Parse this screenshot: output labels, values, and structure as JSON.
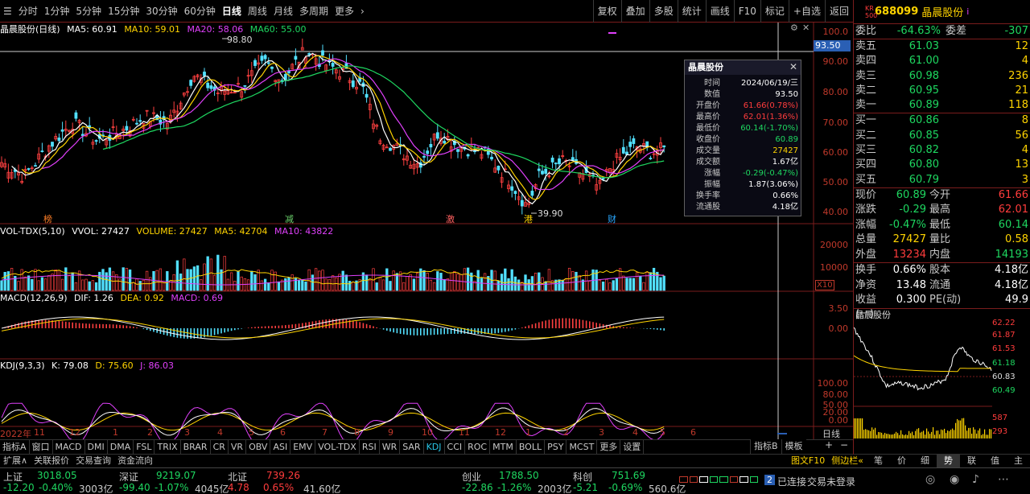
{
  "toolbar": {
    "periods": [
      "分时",
      "1分钟",
      "5分钟",
      "15分钟",
      "30分钟",
      "60分钟",
      "日线",
      "周线",
      "月线",
      "多周期",
      "更多"
    ],
    "active": "日线",
    "right_buttons": [
      "复权",
      "叠加",
      "多股",
      "统计",
      "画线",
      "F10",
      "标记",
      "+自选",
      "返回"
    ]
  },
  "main_chart": {
    "title": "晶晨股份(日线)",
    "ma5": "MA5: 60.91",
    "ma10": "MA10: 59.01",
    "ma20": "MA20: 58.06",
    "ma60": "MA60: 55.00",
    "high_mark": "98.80",
    "low_mark": "39.90",
    "cursor_price": "93.50",
    "y_labels": [
      "100.0",
      "90.00",
      "80.00",
      "70.00",
      "60.00",
      "50.00",
      "40.00"
    ],
    "event_marks": [
      "榜",
      "减",
      "激",
      "港",
      "财"
    ]
  },
  "popup": {
    "title": "晶晨股份",
    "rows": [
      {
        "k": "时间",
        "v": "2024/06/19/三",
        "c": "wht"
      },
      {
        "k": "数值",
        "v": "93.50",
        "c": "wht"
      },
      {
        "k": "开盘价",
        "v": "61.66(0.78%)",
        "c": "red"
      },
      {
        "k": "最高价",
        "v": "62.01(1.36%)",
        "c": "red"
      },
      {
        "k": "最低价",
        "v": "60.14(-1.70%)",
        "c": "grn"
      },
      {
        "k": "收盘价",
        "v": "60.89",
        "c": "grn"
      },
      {
        "k": "成交量",
        "v": "27427",
        "c": "yel"
      },
      {
        "k": "成交额",
        "v": "1.67亿",
        "c": "wht"
      },
      {
        "k": "涨幅",
        "v": "-0.29(-0.47%)",
        "c": "grn"
      },
      {
        "k": "振幅",
        "v": "1.87(3.06%)",
        "c": "wht"
      },
      {
        "k": "换手率",
        "v": "0.66%",
        "c": "wht"
      },
      {
        "k": "流通股",
        "v": "4.18亿",
        "c": "wht"
      }
    ]
  },
  "volume": {
    "label": "VOL-TDX(5,10)",
    "vvol": "VVOL: 27427",
    "volume": "VOLUME: 27427",
    "ma5": "MA5: 42704",
    "ma10": "MA10: 43822",
    "y_labels": [
      "20000",
      "10000"
    ],
    "unit": "X10"
  },
  "macd": {
    "label": "MACD(12,26,9)",
    "dif": "DIF: 1.26",
    "dea": "DEA: 0.92",
    "macd": "MACD: 0.69",
    "y_labels": [
      "3.50",
      "0.00"
    ]
  },
  "kdj": {
    "label": "KDJ(9,3,3)",
    "k": "K: 79.08",
    "d": "D: 75.60",
    "j": "J: 86.03",
    "y_labels": [
      "100.00",
      "80.00",
      "50.00",
      "20.00",
      "0.00"
    ]
  },
  "time_axis": [
    "2022年",
    "11",
    "12",
    "1",
    "2",
    "3",
    "4",
    "5",
    "6",
    "7",
    "8",
    "9",
    "10",
    "11",
    "12",
    "1",
    "2",
    "3",
    "4",
    "5",
    "6"
  ],
  "time_axis_right": "日线",
  "indicator_tabs": [
    "指标A",
    "窗口",
    "MACD",
    "DMI",
    "DMA",
    "FSL",
    "TRIX",
    "BRAR",
    "CR",
    "VR",
    "OBV",
    "ASI",
    "EMV",
    "VOL-TDX",
    "RSI",
    "WR",
    "SAR",
    "KDJ",
    "CCI",
    "ROC",
    "MTM",
    "BOLL",
    "PSY",
    "MCST",
    "更多",
    "设置"
  ],
  "indicator_active": "KDJ",
  "indicator_right": [
    "指标B",
    "模板"
  ],
  "bottom_tabs": [
    "扩展∧",
    "关联报价",
    "交易查询",
    "资金流向"
  ],
  "bottom_right_tabs": [
    "图文F10",
    "侧边栏«",
    "笔",
    "价",
    "细",
    "势",
    "联",
    "值",
    "主"
  ],
  "quote": {
    "code_label": "688099",
    "name": "晶晨股份",
    "tag": "KR",
    "tag2": "500",
    "weibi": {
      "k": "委比",
      "v": "-64.63%",
      "k2": "委差",
      "v2": "-307"
    },
    "sells": [
      {
        "k": "卖五",
        "p": "61.03",
        "q": "12"
      },
      {
        "k": "卖四",
        "p": "61.00",
        "q": "4"
      },
      {
        "k": "卖三",
        "p": "60.98",
        "q": "236"
      },
      {
        "k": "卖二",
        "p": "60.95",
        "q": "21"
      },
      {
        "k": "卖一",
        "p": "60.89",
        "q": "118"
      }
    ],
    "buys": [
      {
        "k": "买一",
        "p": "60.86",
        "q": "8"
      },
      {
        "k": "买二",
        "p": "60.85",
        "q": "56"
      },
      {
        "k": "买三",
        "p": "60.82",
        "q": "4"
      },
      {
        "k": "买四",
        "p": "60.80",
        "q": "13"
      },
      {
        "k": "买五",
        "p": "60.79",
        "q": "3"
      }
    ],
    "stats1": [
      {
        "k": "现价",
        "v": "60.89",
        "vc": "grn",
        "k2": "今开",
        "v2": "61.66",
        "v2c": "red"
      },
      {
        "k": "涨跌",
        "v": "-0.29",
        "vc": "grn",
        "k2": "最高",
        "v2": "62.01",
        "v2c": "red"
      },
      {
        "k": "涨幅",
        "v": "-0.47%",
        "vc": "grn",
        "k2": "最低",
        "v2": "60.14",
        "v2c": "grn"
      },
      {
        "k": "总量",
        "v": "27427",
        "vc": "yel",
        "k2": "量比",
        "v2": "0.58",
        "v2c": "yel"
      },
      {
        "k": "外盘",
        "v": "13234",
        "vc": "red",
        "k2": "内盘",
        "v2": "14193",
        "v2c": "grn"
      }
    ],
    "stats2": [
      {
        "k": "换手",
        "v": "0.66%",
        "vc": "wht",
        "k2": "股本",
        "v2": "4.18亿",
        "v2c": "wht"
      },
      {
        "k": "净资",
        "v": "13.48",
        "vc": "wht",
        "k2": "流通",
        "v2": "4.18亿",
        "v2c": "wht"
      },
      {
        "k": "收益(一)",
        "v": "0.300",
        "vc": "wht",
        "k2": "PE(动)",
        "v2": "49.9",
        "v2c": "wht"
      }
    ],
    "mini_title": "晶晨股份",
    "mini_labels": [
      "62.22",
      "61.87",
      "61.53",
      "61.18",
      "60.83",
      "60.49",
      "587",
      "293"
    ]
  },
  "status": {
    "indices": [
      {
        "name": "上证",
        "val": "3018.05",
        "chg": "-12.20",
        "pct": "-0.40%",
        "amt": "3003亿",
        "c": "grn"
      },
      {
        "name": "深证",
        "val": "9219.07",
        "chg": "-99.40",
        "pct": "-1.07%",
        "amt": "4045亿",
        "c": "grn"
      },
      {
        "name": "北证",
        "val": "739.26",
        "chg": "4.78",
        "pct": "0.65%",
        "amt": "41.60亿",
        "c": "red"
      },
      {
        "name": "创业",
        "val": "1788.50",
        "chg": "-22.86",
        "pct": "-1.26%",
        "amt": "2003亿",
        "c": "grn"
      },
      {
        "name": "科创",
        "val": "751.69",
        "chg": "-5.21",
        "pct": "-0.69%",
        "amt": "560.6亿",
        "c": "grn"
      }
    ],
    "conn_num": "2",
    "conn": "已连接",
    "trade": "交易未登录"
  }
}
